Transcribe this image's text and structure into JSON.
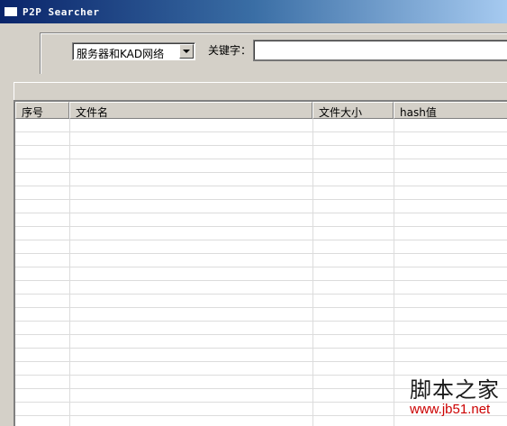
{
  "window": {
    "title": "P2P Searcher"
  },
  "search": {
    "source_selected": "服务器和KAD网络",
    "keyword_label": "关键字：",
    "keyword_value": ""
  },
  "table": {
    "columns": [
      "序号",
      "文件名",
      "文件大小",
      "hash值"
    ],
    "rows": []
  },
  "watermark": {
    "text": "脚本之家",
    "url": "www.jb51.net"
  },
  "icons": [
    "window-icon",
    "chevron-down-icon"
  ]
}
